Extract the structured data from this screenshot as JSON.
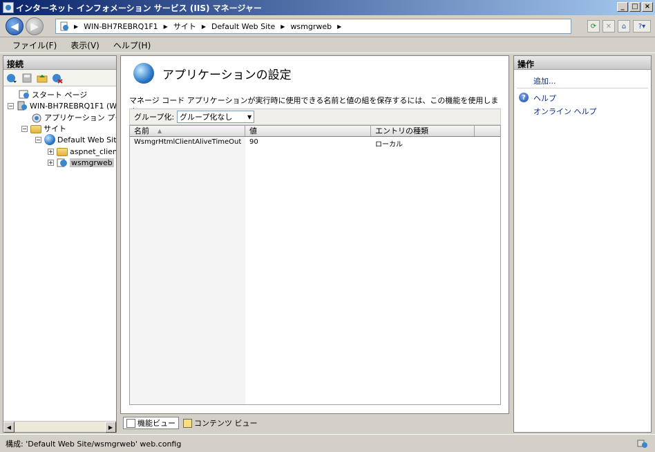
{
  "window": {
    "title": "インターネット インフォメーション サービス (IIS) マネージャー"
  },
  "address": {
    "segments": [
      "WIN-BH7REBRQ1F1",
      "サイト",
      "Default Web Site",
      "wsmgrweb"
    ]
  },
  "menu": {
    "items": [
      "ファイル(F)",
      "表示(V)",
      "ヘルプ(H)"
    ]
  },
  "connections": {
    "header": "接続",
    "tree": {
      "start_page": "スタート ページ",
      "server": "WIN-BH7REBRQ1F1 (W",
      "app_pools": "アプリケーション プール",
      "sites": "サイト",
      "default_site": "Default Web Sit",
      "aspnet_client": "aspnet_clien",
      "wsmgrweb": "wsmgrweb"
    }
  },
  "main": {
    "title": "アプリケーションの設定",
    "description": "マネージ コード アプリケーションが実行時に使用できる名前と値の組を保存するには、この機能を使用します",
    "group_label": "グループ化:",
    "group_value": "グループ化なし",
    "columns": [
      "名前",
      "値",
      "エントリの種類"
    ],
    "rows": [
      {
        "name": "WsmgrHtmlClientAliveTimeOut",
        "value": "90",
        "type": "ローカル"
      }
    ],
    "tabs": {
      "features": "機能ビュー",
      "content": "コンテンツ ビュー"
    }
  },
  "actions": {
    "header": "操作",
    "add": "追加...",
    "help": "ヘルプ",
    "online_help": "オンライン ヘルプ"
  },
  "status": {
    "text": "構成: 'Default Web Site/wsmgrweb' web.config"
  }
}
